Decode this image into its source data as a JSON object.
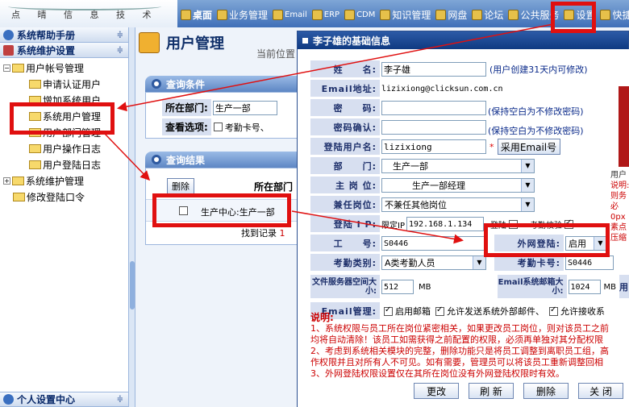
{
  "header": {
    "logo_text": "点 晴 信 息 技 术",
    "menu": [
      {
        "label": "桌面",
        "icon": "desktop-icon",
        "bold": true
      },
      {
        "label": "业务管理",
        "icon": "business-icon"
      },
      {
        "label": "Email",
        "icon": "email-icon"
      },
      {
        "label": "ERP",
        "icon": "erp-icon"
      },
      {
        "label": "CDM",
        "icon": "cdm-icon"
      },
      {
        "label": "知识管理",
        "icon": "knowledge-icon"
      },
      {
        "label": "网盘",
        "icon": "netdisk-icon"
      },
      {
        "label": "论坛",
        "icon": "forum-icon"
      },
      {
        "label": "公共服务",
        "icon": "public-service-icon"
      },
      {
        "label": "设置",
        "icon": "settings-icon"
      },
      {
        "label": "快捷",
        "icon": "shortcut-icon"
      }
    ]
  },
  "sidebar": {
    "help_title": "系统帮助手册",
    "maint_title": "系统维护设置",
    "tree": [
      {
        "label": "用户帐号管理",
        "level": 0,
        "type": "root-open"
      },
      {
        "label": "申请认证用户",
        "level": 1
      },
      {
        "label": "增加系统用户",
        "level": 1
      },
      {
        "label": "系统用户管理",
        "level": 1
      },
      {
        "label": "用户部门管理",
        "level": 1
      },
      {
        "label": "用户操作日志",
        "level": 1
      },
      {
        "label": "用户登陆日志",
        "level": 1
      },
      {
        "label": "系统维护管理",
        "level": 0,
        "type": "root-closed"
      },
      {
        "label": "修改登陆口令",
        "level": 0,
        "type": "leaf"
      }
    ],
    "footer_title": "个人设置中心"
  },
  "main": {
    "page_title": "用户管理",
    "location": "当前位置",
    "query": {
      "title": "查询条件",
      "dept_label": "所在部门:",
      "dept_value": "生产一部",
      "options_label": "查看选项:",
      "option_1": "考勤卡号、"
    },
    "results": {
      "title": "查询结果",
      "delete_btn": "删除",
      "col_dept": "所在部门",
      "row_dept": "生产中心:生产一部",
      "found_label": "找到记录",
      "found_count": "1"
    }
  },
  "dialog": {
    "title": "李子雄的基础信息",
    "fields": {
      "name_label": "姓　　名:",
      "name_value": "李子雄",
      "name_hint": "(用户创建31天内可修改)",
      "email_label": "Email地址:",
      "email_value": "lizixiong@clicksun.com.cn",
      "pwd_label": "密　　码:",
      "pwd_hint": "(保持空白为不修改密码)",
      "pwd2_label": "密码确认:",
      "pwd2_hint": "(保持空白为不修改密码)",
      "login_label": "登陆用户名:",
      "login_value": "lizixiong",
      "login_btn": "采用Email号",
      "dept_label": "部　　门:",
      "dept_value": "生产一部",
      "post_label": "主 岗 位:",
      "post_value": "生产一部经理",
      "post2_label": "兼任岗位:",
      "post2_value": "不兼任其他岗位",
      "ip_label": "登陆 I P:",
      "ip_prefix": "限定IP",
      "ip_value": "192.168.1.134",
      "ip_suffix_1": "登陆",
      "ip_suffix_2": "考勤校验",
      "empno_label": "工　　号:",
      "empno_value": "S0446",
      "extlogin_label": "外网登陆:",
      "extlogin_value": "启用",
      "att_type_label": "考勤类别:",
      "att_type_value": "A类考勤人员",
      "att_card_label": "考勤卡号:",
      "att_card_value": "S0446",
      "fs_label": "文件服务器空间大小:",
      "fs_value": "512",
      "fs_unit": "MB",
      "mail_size_label": "Email系统邮箱大小:",
      "mail_size_value": "1024",
      "mail_size_unit": "MB",
      "user_label": "用户",
      "email_mgmt_label": "Email管理:",
      "email_opt_1": "启用邮箱",
      "email_opt_2": "允许发送系统外部邮件、",
      "email_opt_3": "允许接收系"
    },
    "right_col": {
      "line1": "用户",
      "line2": "说明:",
      "line3": "则务必",
      "line4": "0px",
      "line5": "素点",
      "line6": "压缩"
    },
    "notes": {
      "title": "说明:",
      "n1": "1、系统权限与员工所在岗位紧密相关，如果更改员工岗位，则对该员工之前",
      "n1b": "均将自动清除！该员工如需获得之前配置的权限，必须再单独对其分配权限",
      "n2": "2、考虑到系统相关模块的完整，删除功能只是将员工调整到离职员工组，高",
      "n2b": "作权限并且对所有人不可见。如有需要，管理员可以将该员工重新调整回相",
      "n3": "3、外网登陆权限设置仅在其所在岗位没有外网登陆权限时有效。"
    },
    "buttons": {
      "modify": "更改",
      "refresh": "刷 新",
      "delete": "删除",
      "close": "关 闭"
    }
  },
  "colors": {
    "highlight": "#e01010",
    "header_blue": "#3f6fb8",
    "label_bg": "#d7dff0"
  }
}
